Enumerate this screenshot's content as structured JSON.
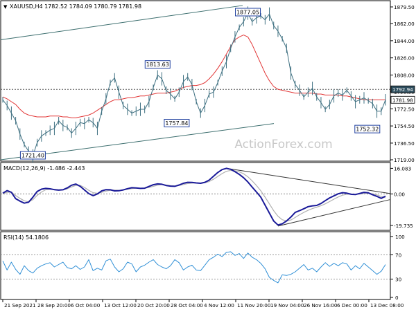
{
  "chart_data": [
    {
      "type": "line",
      "title": "XAUUSD,H4  1782.52 1784.09 1780.79 1781.98",
      "subtitle": "",
      "watermark": "ActionForex.com",
      "symbol_marker": "▼",
      "y_axis_ticks": [
        "1879.50",
        "1862.00",
        "1844.00",
        "1826.00",
        "1808.00",
        "1790.50",
        "1772.50",
        "1754.50",
        "1736.50",
        "1719.00"
      ],
      "ylim": [
        1719.0,
        1879.5
      ],
      "price_label": "1781.98",
      "level_label": "1792.94",
      "level_value": 1792.94,
      "annotations": [
        {
          "text": "1877.05",
          "value": 1877.05
        },
        {
          "text": "1813.63",
          "value": 1813.63
        },
        {
          "text": "1757.84",
          "value": 1757.84
        },
        {
          "text": "1752.32",
          "value": 1752.32
        },
        {
          "text": "1721.40",
          "value": 1721.4
        }
      ],
      "series": [
        {
          "name": "",
          "values": [
            1782,
            1776,
            1768,
            1760,
            1746,
            1735,
            1728,
            1723,
            1737,
            1744,
            1747,
            1750,
            1752,
            1760,
            1755,
            1753,
            1747,
            1752,
            1758,
            1757,
            1761,
            1758,
            1752,
            1770,
            1783,
            1800,
            1805,
            1790,
            1776,
            1772,
            1768,
            1770,
            1772,
            1772,
            1780,
            1795,
            1808,
            1804,
            1792,
            1788,
            1783,
            1790,
            1801,
            1806,
            1798,
            1780,
            1768,
            1776,
            1788,
            1790,
            1800,
            1812,
            1822,
            1836,
            1848,
            1858,
            1864,
            1873,
            1864,
            1868,
            1870,
            1866,
            1872,
            1860,
            1854,
            1846,
            1836,
            1810,
            1798,
            1792,
            1785,
            1790,
            1794,
            1785,
            1779,
            1772,
            1777,
            1786,
            1789,
            1787,
            1792,
            1786,
            1780,
            1782,
            1784,
            1781,
            1778,
            1770,
            1770,
            1782
          ]
        },
        {
          "name": "",
          "values": [
            1785,
            1783,
            1780,
            1777,
            1772,
            1768,
            1766,
            1765,
            1764,
            1764,
            1764,
            1765,
            1765,
            1765,
            1764,
            1764,
            1763,
            1763,
            1764,
            1765,
            1766,
            1768,
            1771,
            1774,
            1777,
            1780,
            1782,
            1782,
            1783,
            1784,
            1784,
            1785,
            1786,
            1786,
            1787,
            1788,
            1789,
            1789,
            1789,
            1790,
            1791,
            1793,
            1795,
            1796,
            1797,
            1797,
            1798,
            1800,
            1804,
            1809,
            1815,
            1822,
            1830,
            1838,
            1845,
            1848,
            1850,
            1848,
            1840,
            1830,
            1820,
            1810,
            1802,
            1796,
            1793,
            1792,
            1791,
            1790,
            1789,
            1789,
            1789,
            1789,
            1789,
            1788,
            1788,
            1787,
            1787,
            1787,
            1787,
            1786,
            1786,
            1785,
            1784,
            1783,
            1782,
            1782,
            1782,
            1782,
            1782,
            1782
          ]
        }
      ],
      "channel_lines": [
        {
          "start": 1845,
          "end": 1881
        },
        {
          "start": 1719,
          "end": 1757
        }
      ]
    },
    {
      "type": "line",
      "title": "MACD(12,26,9) -1.486 -2.443",
      "y_axis_ticks": [
        "16.083",
        "0.00",
        "-19.735"
      ],
      "ylim": [
        -22,
        18
      ],
      "zero_value": 0,
      "series": [
        {
          "name": "",
          "values": [
            0.5,
            2.1,
            1.0,
            -3.0,
            -4.5,
            -5.8,
            -5.2,
            -2.1,
            1.5,
            3.0,
            3.5,
            3.2,
            2.7,
            2.4,
            2.6,
            3.8,
            5.5,
            6.2,
            4.8,
            2.5,
            0.2,
            -1.1,
            0.0,
            1.9,
            2.7,
            2.6,
            1.9,
            2.0,
            2.5,
            3.3,
            3.9,
            3.8,
            3.5,
            3.6,
            4.7,
            5.8,
            6.3,
            6.1,
            5.3,
            4.9,
            4.8,
            5.6,
            6.7,
            7.3,
            7.2,
            6.9,
            6.7,
            7.3,
            8.7,
            11.1,
            13.5,
            15.3,
            16.1,
            15.5,
            14.0,
            12.3,
            10.2,
            7.5,
            4.3,
            1.2,
            -2.0,
            -7.0,
            -12.0,
            -17.0,
            -19.5,
            -18.8,
            -17.0,
            -14.5,
            -11.6,
            -10.5,
            -9.3,
            -8.0,
            -7.5,
            -7.2,
            -6.0,
            -4.2,
            -2.5,
            -1.2,
            0.1,
            0.8,
            0.5,
            -0.2,
            -0.4,
            0.3,
            1.0,
            0.7,
            -0.5,
            -1.5,
            -2.8,
            -1.4
          ]
        },
        {
          "name": "",
          "values": [
            0.0,
            1.0,
            1.2,
            -1.0,
            -2.8,
            -4.3,
            -5.0,
            -3.6,
            -0.9,
            1.2,
            2.6,
            3.0,
            2.9,
            2.6,
            2.6,
            3.2,
            4.4,
            5.4,
            5.4,
            4.1,
            2.3,
            0.8,
            0.4,
            1.0,
            1.8,
            2.3,
            2.4,
            2.3,
            2.4,
            2.9,
            3.4,
            3.6,
            3.6,
            3.6,
            4.1,
            4.8,
            5.5,
            5.9,
            5.6,
            5.2,
            5.0,
            5.3,
            5.9,
            6.5,
            6.8,
            6.9,
            6.8,
            7.0,
            7.8,
            9.2,
            11.0,
            12.8,
            14.2,
            14.8,
            14.6,
            13.9,
            12.7,
            10.8,
            8.2,
            5.3,
            2.0,
            -2.0,
            -6.2,
            -10.5,
            -14.0,
            -16.2,
            -17.0,
            -16.4,
            -14.8,
            -13.1,
            -11.6,
            -10.3,
            -9.2,
            -8.3,
            -7.4,
            -6.2,
            -4.8,
            -3.3,
            -1.9,
            -0.8,
            -0.2,
            -0.1,
            -0.2,
            -0.1,
            0.3,
            0.5,
            0.1,
            -0.6,
            -1.6,
            -2.4
          ]
        }
      ],
      "trend_lines": [
        {
          "from_index": 52,
          "from_value": 16.1,
          "to_index": 90,
          "to_value": 0.3
        },
        {
          "from_index": 64,
          "from_value": -20.2,
          "to_index": 90,
          "to_value": -3.6
        }
      ]
    },
    {
      "type": "line",
      "title": "RSI(14) 54.1806",
      "y_axis_ticks": [
        "100",
        "70",
        "30",
        "0"
      ],
      "ylim": [
        0,
        100
      ],
      "levels": [
        70,
        30
      ],
      "series": [
        {
          "name": "",
          "values": [
            60,
            45,
            58,
            46,
            38,
            52,
            44,
            40,
            48,
            52,
            55,
            57,
            50,
            54,
            58,
            49,
            47,
            52,
            46,
            50,
            62,
            44,
            48,
            45,
            60,
            63,
            50,
            42,
            47,
            58,
            55,
            42,
            50,
            53,
            58,
            62,
            54,
            50,
            47,
            52,
            62,
            57,
            45,
            50,
            53,
            45,
            44,
            53,
            62,
            66,
            71,
            67,
            74,
            75,
            69,
            72,
            64,
            73,
            66,
            62,
            56,
            47,
            33,
            28,
            24,
            37,
            36,
            38,
            42,
            48,
            54,
            45,
            48,
            42,
            50,
            57,
            51,
            56,
            52,
            57,
            55,
            45,
            52,
            47,
            56,
            50,
            44,
            38,
            43,
            54
          ]
        }
      ]
    }
  ],
  "x_axis_labels": [
    "21 Sep 2021",
    "28 Sep 20:00",
    "6 Oct 04:00",
    "13 Oct 12:00",
    "20 Oct 20:00",
    "28 Oct 04:00",
    "4 Nov 12:00",
    "11 Nov 20:00",
    "19 Nov 04:00",
    "26 Nov 16:00",
    "6 Dec 00:00",
    "13 Dec 08:00"
  ],
  "colors": {
    "price": "#3d6f80",
    "moving_average": "#e23636",
    "channel": "#3c6e6e",
    "macd": "#1a1a99",
    "signal": "#b0b0b0",
    "rsi": "#2f8fd6",
    "box_border": "#1f3f9f"
  }
}
